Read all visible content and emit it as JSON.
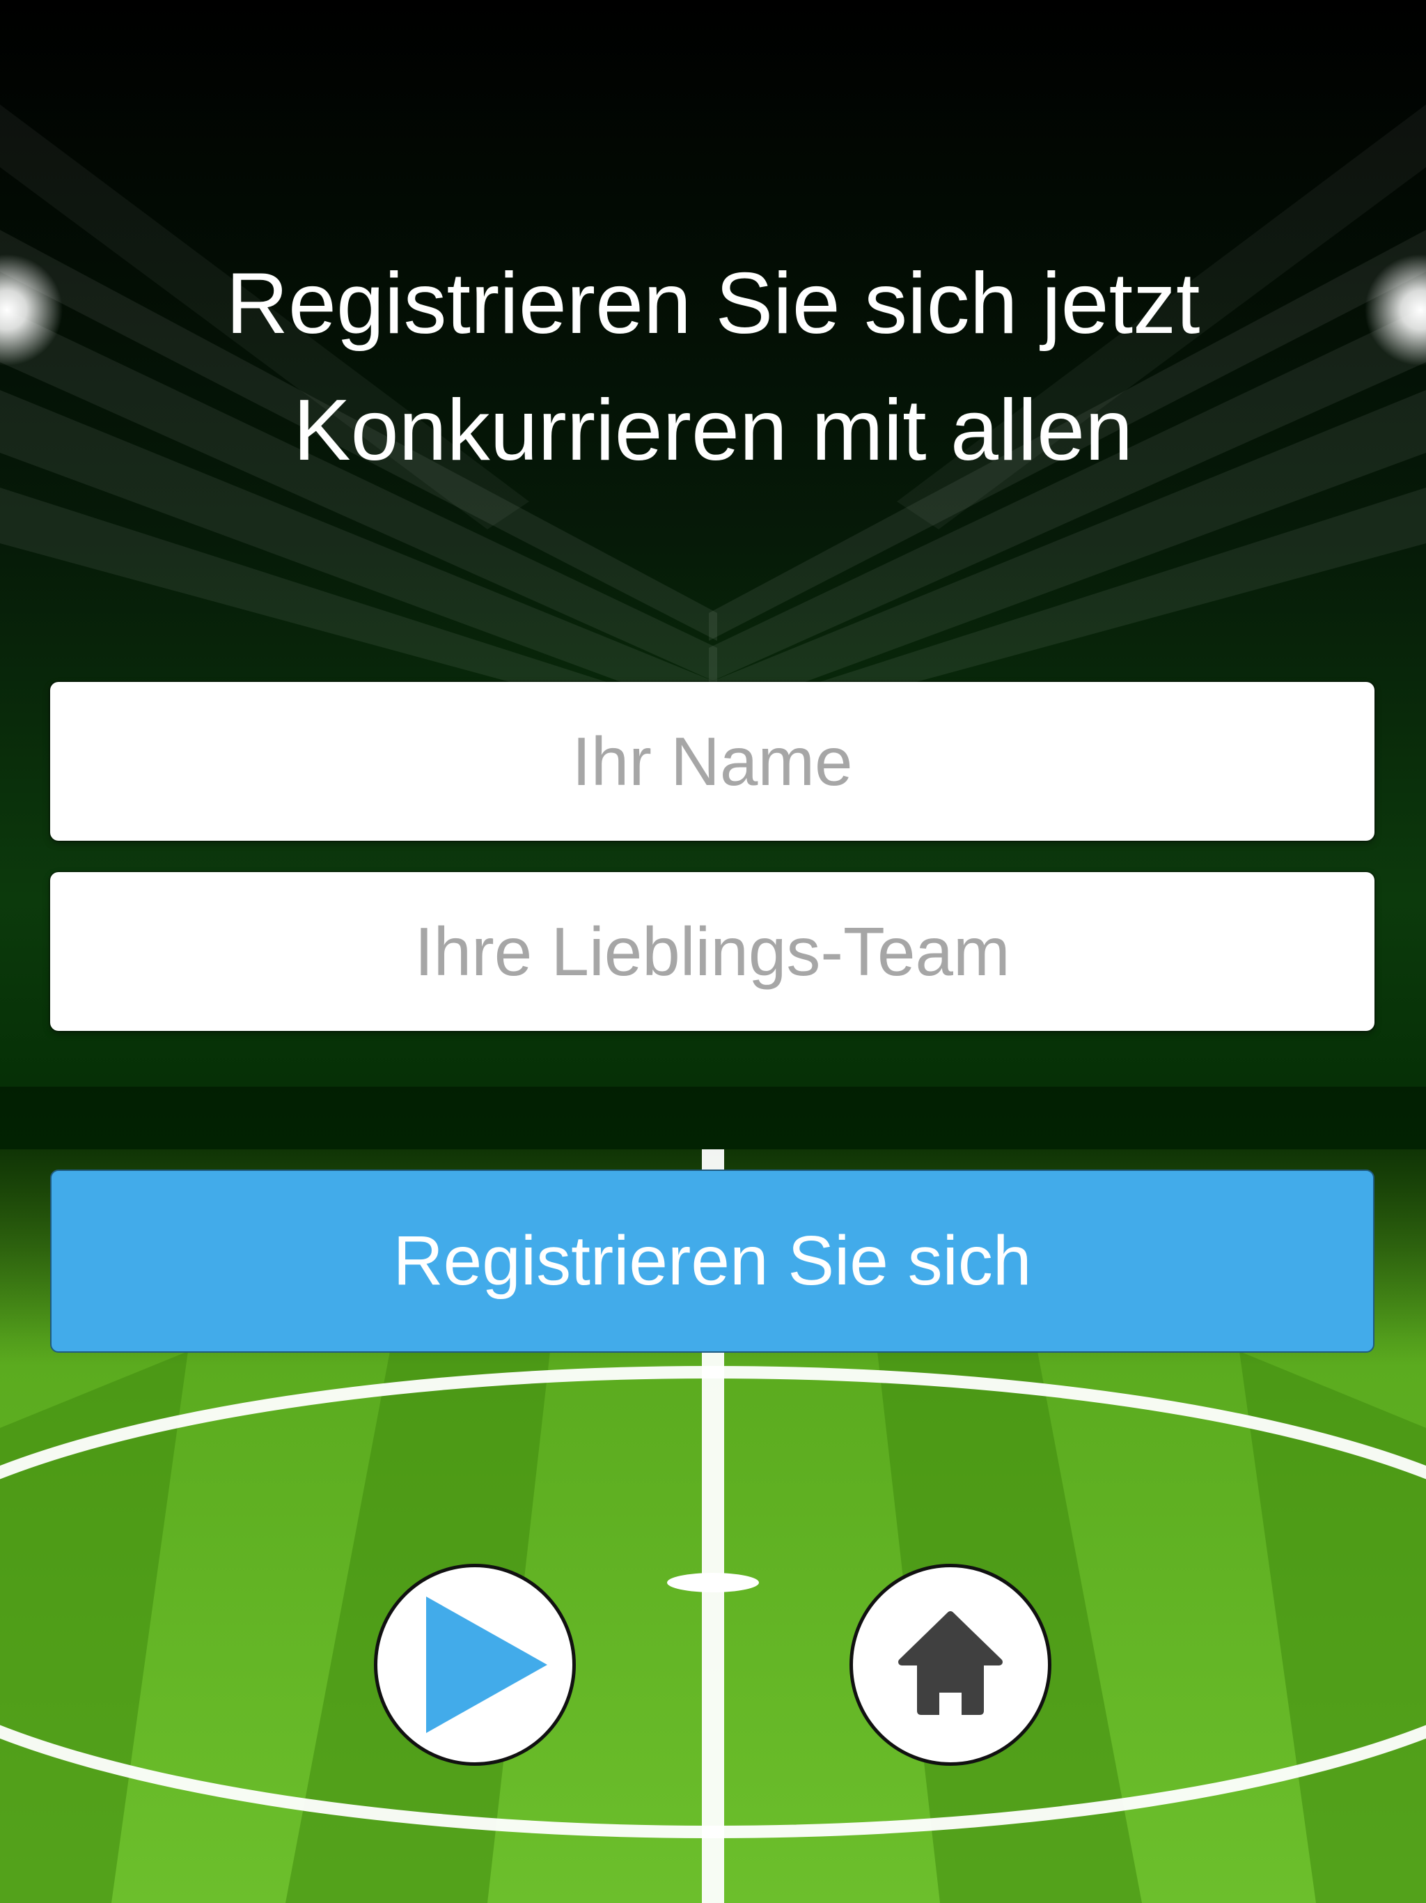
{
  "header": {
    "line1": "Registrieren Sie sich jetzt",
    "line2": "Konkurrieren mit allen"
  },
  "form": {
    "name_placeholder": "Ihr Name",
    "team_placeholder": "Ihre Lieblings-Team",
    "register_label": "Registrieren Sie sich"
  },
  "controls": {
    "play_icon": "play-icon",
    "home_icon": "home-icon"
  },
  "colors": {
    "accent": "#42abea",
    "pitch_green_light": "#6cbf2c",
    "pitch_green_dark": "#4a9a12",
    "night_sky": "#000000",
    "home_icon": "#404040"
  }
}
